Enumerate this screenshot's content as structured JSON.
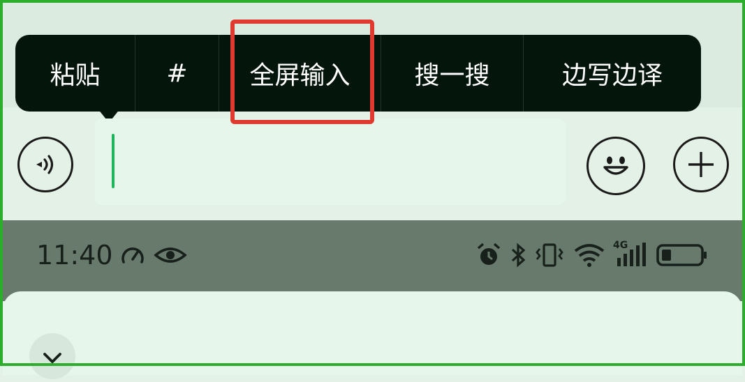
{
  "context_menu": {
    "items": [
      {
        "label": "粘贴"
      },
      {
        "label": "#"
      },
      {
        "label": "全屏输入"
      },
      {
        "label": "搜一搜"
      },
      {
        "label": "边写边译"
      }
    ],
    "highlighted_item": "全屏输入",
    "highlight_color": "#e03a2e"
  },
  "chat_input": {
    "value": "",
    "caret_color": "#1fb35b",
    "icons": {
      "voice": "voice-icon",
      "emoji": "emoji-icon",
      "more": "plus-icon"
    }
  },
  "status_bar": {
    "time": "11:40",
    "network_label": "4G",
    "icons": [
      "speed-icon",
      "eye-icon",
      "alarm-icon",
      "bluetooth-icon",
      "vibrate-icon",
      "wifi-icon",
      "signal-icon",
      "battery-icon"
    ],
    "battery_level": 0.25
  },
  "bottom_sheet": {
    "icons": [
      "chevron-down-icon"
    ]
  },
  "colors": {
    "frame": "#2cad2c",
    "menu_background": "#04150c",
    "status_bar_background": "#687a6c"
  }
}
